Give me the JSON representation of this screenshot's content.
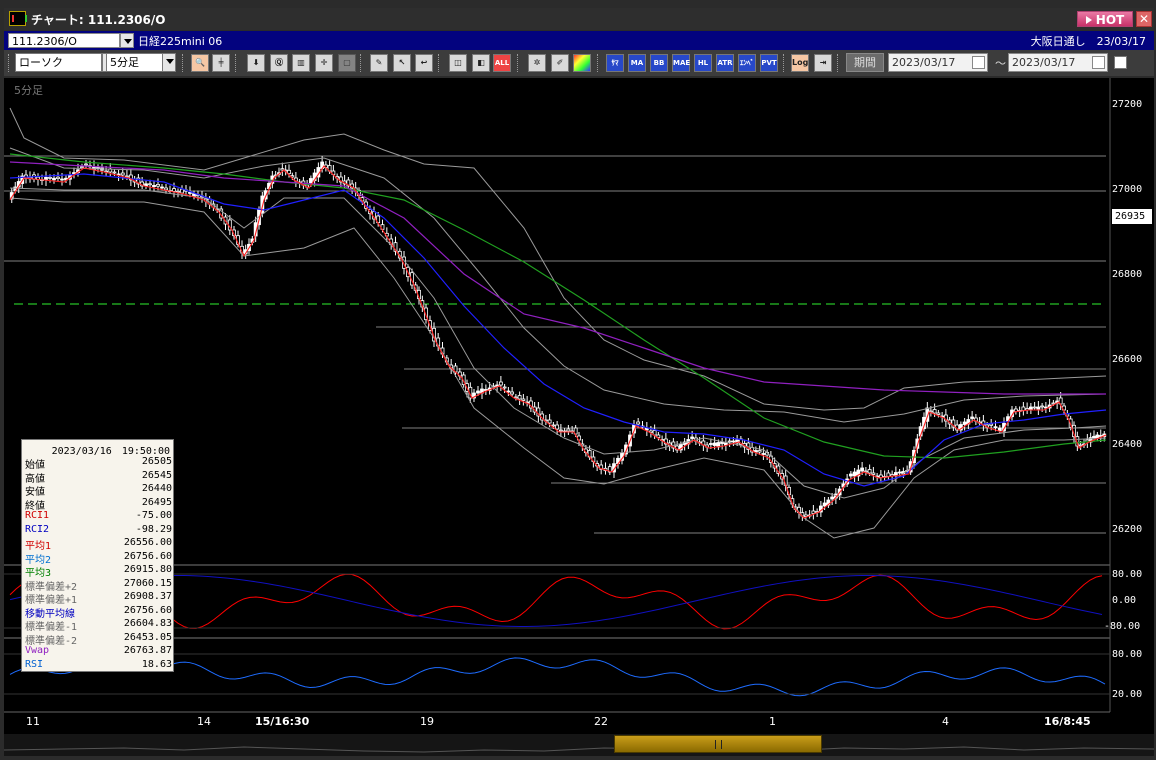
{
  "window": {
    "title": "チャート: 111.2306/O",
    "hot_label": "HOT",
    "close_glyph": "✕"
  },
  "symbol_bar": {
    "symbol": "111.2306/O",
    "instrument": "日経225mini 06",
    "market_info": "大阪日通し　23/03/17"
  },
  "toolbar": {
    "chart_type": "ローソク",
    "timeframe": "5分足",
    "period_label": "期間",
    "date_from": "2023/03/17",
    "date_to": "2023/03/17",
    "tilde": "～",
    "buttons": [
      "zoom-icon",
      "crosshair-icon",
      "download-icon",
      "search-chart-icon",
      "bar-edit-icon",
      "candle-color-icon",
      "disabled-icon",
      "pen-icon",
      "cursor-icon",
      "undo-icon",
      "lock-icon",
      "trace-icon",
      "all-label",
      "palette-icon",
      "paintbrush-icon",
      "gradient-icon"
    ],
    "indicator_buttons": [
      "ｻﾏ",
      "MA",
      "BB",
      "MAE",
      "HL",
      "ATR",
      "ｴﾝﾍﾞ",
      "PVT",
      "Log"
    ]
  },
  "chart": {
    "timeframe_label": "5分足",
    "y_axis_ticks": [
      "27200",
      "27000",
      "26800",
      "26600",
      "26400",
      "26200"
    ],
    "current_price": "26935",
    "rci_ticks": [
      "80.00",
      "0.00",
      "-80.00"
    ],
    "rsi_ticks": [
      "80.00",
      "20.00"
    ],
    "x_axis_labels": [
      {
        "text": "11",
        "bold": false
      },
      {
        "text": "14",
        "bold": false
      },
      {
        "text": "15/16:30",
        "bold": true
      },
      {
        "text": "19",
        "bold": false
      },
      {
        "text": "22",
        "bold": false
      },
      {
        "text": "1",
        "bold": false
      },
      {
        "text": "4",
        "bold": false
      },
      {
        "text": "16/8:45",
        "bold": true
      }
    ],
    "colors": {
      "background": "#000000",
      "candle_up": "#ffffff",
      "candle_down": "#000000",
      "ma1": "#ff2020",
      "ma2": "#2020ff",
      "ma3": "#20a020",
      "vwap": "#9020c0",
      "bands": "#9a9a9a",
      "rci1": "#ff0000",
      "rci2": "#1010c0",
      "rsi": "#1e6cff",
      "dashed_level": "#20a020"
    }
  },
  "info_panel": {
    "header": "2023/03/16　19:50:00",
    "rows": [
      {
        "key": "始値",
        "value": "26505",
        "color": "#000000"
      },
      {
        "key": "高値",
        "value": "26545",
        "color": "#000000"
      },
      {
        "key": "安値",
        "value": "26440",
        "color": "#000000"
      },
      {
        "key": "終値",
        "value": "26495",
        "color": "#000000"
      },
      {
        "key": "RCI1",
        "value": "-75.00",
        "color": "#d00000"
      },
      {
        "key": "RCI2",
        "value": "-98.29",
        "color": "#0000c0"
      },
      {
        "key": "平均1",
        "value": "26556.00",
        "color": "#d00000"
      },
      {
        "key": "平均2",
        "value": "26756.60",
        "color": "#0070d0"
      },
      {
        "key": "平均3",
        "value": "26915.80",
        "color": "#008000"
      },
      {
        "key": "標準偏差+2",
        "value": "27060.15",
        "color": "#666666"
      },
      {
        "key": "標準偏差+1",
        "value": "26908.37",
        "color": "#666666"
      },
      {
        "key": "移動平均線",
        "value": "26756.60",
        "color": "#0000c0"
      },
      {
        "key": "標準偏差-1",
        "value": "26604.83",
        "color": "#666666"
      },
      {
        "key": "標準偏差-2",
        "value": "26453.05",
        "color": "#666666"
      },
      {
        "key": "Vwap",
        "value": "26763.87",
        "color": "#9020c0"
      },
      {
        "key": "RSI",
        "value": "18.63",
        "color": "#0060d0"
      }
    ]
  }
}
